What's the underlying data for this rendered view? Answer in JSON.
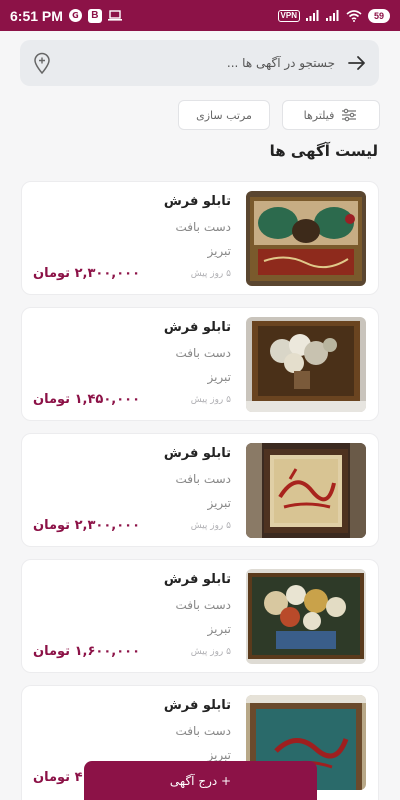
{
  "status_bar": {
    "time": "6:51 PM",
    "notif_badge": "G",
    "app_badge": "B",
    "vpn": "VPN",
    "battery": "59"
  },
  "search": {
    "placeholder": "جستجو در آگهی ها ..."
  },
  "filters": {
    "filter_label": "فیلترها",
    "sort_label": "مرتب سازی"
  },
  "list_title": "لیست آگهی ها",
  "listings": [
    {
      "title": "تابلو فرش",
      "subtitle": "دست بافت",
      "city": "تبریز",
      "time": "۵ روز پیش",
      "price": "۲,۳۰۰,۰۰۰ تومان",
      "image": "calligraphy-carpet"
    },
    {
      "title": "تابلو فرش",
      "subtitle": "دست بافت",
      "city": "تبریز",
      "time": "۵ روز پیش",
      "price": "۱,۴۵۰,۰۰۰ تومان",
      "image": "flower-vase-carpet"
    },
    {
      "title": "تابلو فرش",
      "subtitle": "دست بافت",
      "city": "تبریز",
      "time": "۵ روز پیش",
      "price": "۲,۳۰۰,۰۰۰ تومان",
      "image": "red-calligraphy-carpet"
    },
    {
      "title": "تابلو فرش",
      "subtitle": "دست بافت",
      "city": "تبریز",
      "time": "۵ روز پیش",
      "price": "۱,۶۰۰,۰۰۰ تومان",
      "image": "flower-bouquet-carpet"
    },
    {
      "title": "تابلو فرش",
      "subtitle": "دست بافت",
      "city": "تبریز",
      "time": "",
      "price": "۴ تومان",
      "image": "blue-calligraphy-carpet"
    }
  ],
  "fab": {
    "label": "+ درج آگهی"
  },
  "colors": {
    "brand": "#8c1247",
    "background": "#f6f6f7",
    "search_bg": "#e9ebee"
  }
}
